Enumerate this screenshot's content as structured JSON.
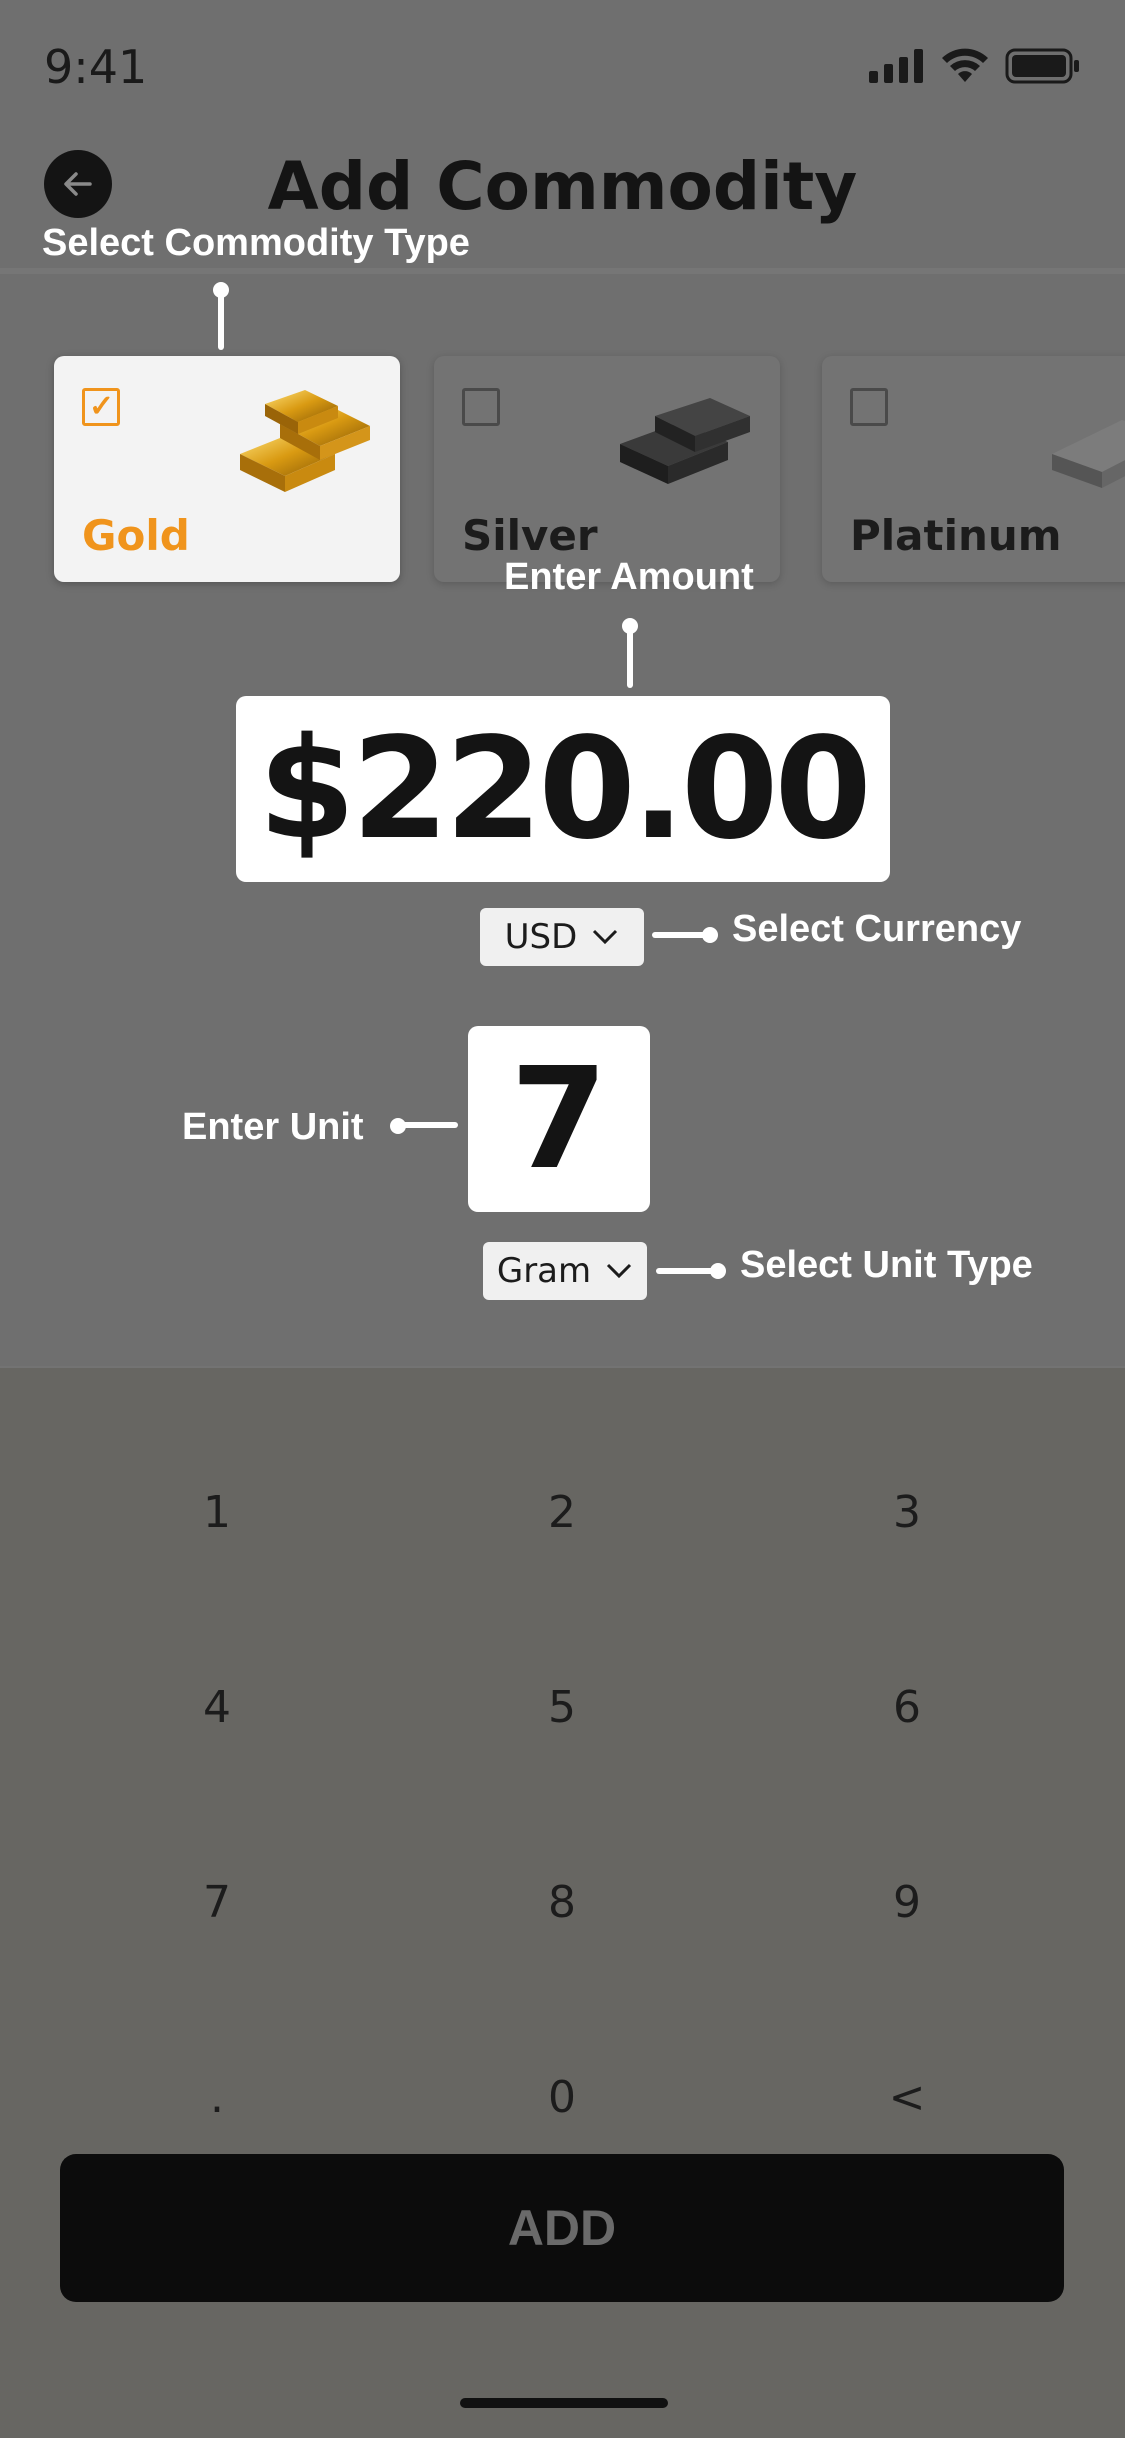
{
  "status_bar": {
    "time": "9:41"
  },
  "header": {
    "title": "Add Commodity"
  },
  "annotations": {
    "commodity_type": "Select Commodity Type",
    "amount": "Enter Amount",
    "currency": "Select Currency",
    "unit": "Enter Unit",
    "unit_type": "Select Unit Type"
  },
  "commodities": [
    {
      "label": "Gold",
      "selected": true,
      "icon": "gold-bars-image"
    },
    {
      "label": "Silver",
      "selected": false,
      "icon": "silver-bars-image"
    },
    {
      "label": "Platinum",
      "selected": false,
      "icon": "platinum-bar-image"
    }
  ],
  "amount": {
    "value": "$220.00"
  },
  "currency": {
    "selected": "USD"
  },
  "unit": {
    "value": "7"
  },
  "unit_type": {
    "selected": "Gram"
  },
  "keypad": {
    "keys": [
      "1",
      "2",
      "3",
      "4",
      "5",
      "6",
      "7",
      "8",
      "9",
      ".",
      "0",
      "<"
    ]
  },
  "actions": {
    "add_label": "ADD"
  },
  "colors": {
    "accent": "#f0941c",
    "overlay": "#6f6f6f",
    "button": "#0c0c0c"
  }
}
